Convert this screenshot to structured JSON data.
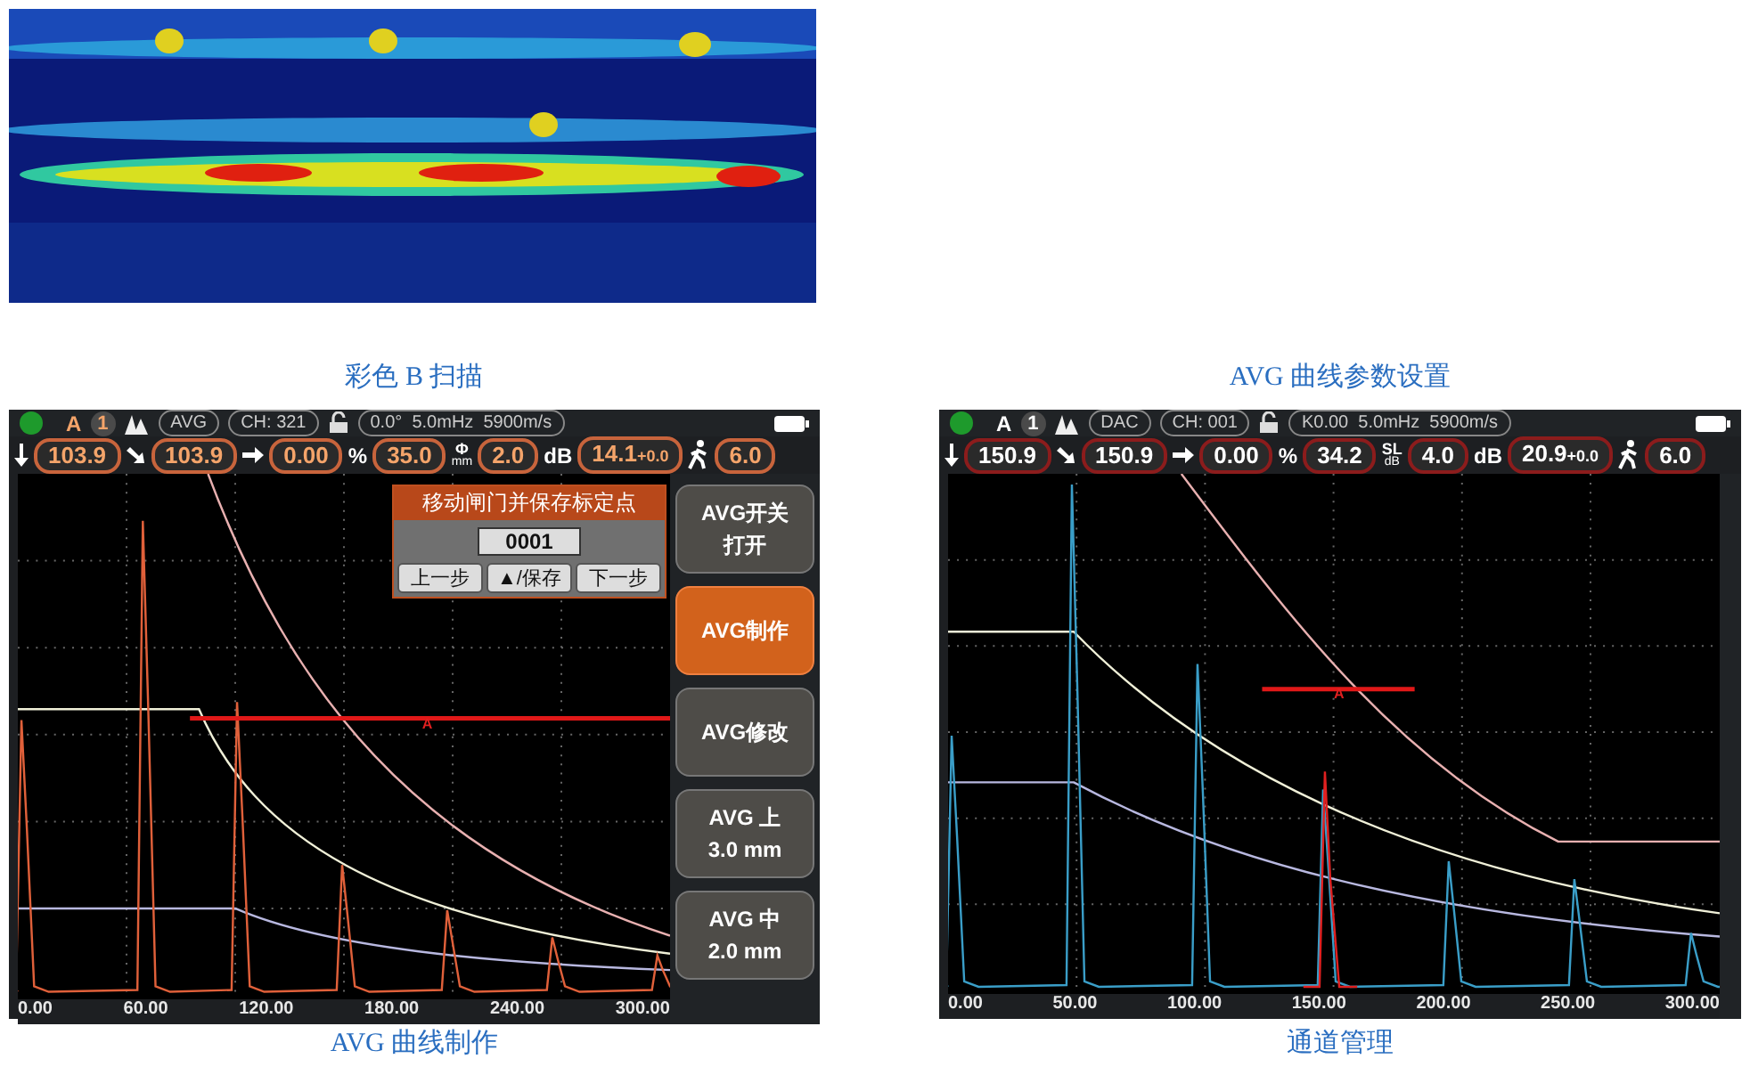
{
  "captions_top": [
    "彩色 B 扫描",
    "AVG 曲线参数设置"
  ],
  "screens": [
    {
      "kind": "orange",
      "mode": "A",
      "number": "1",
      "curve": "AVG",
      "channel": "CH: 321",
      "probe": "0.0°  5.0mHz  5900m/s",
      "readings": [
        {
          "kind": "down",
          "value": "103.9"
        },
        {
          "kind": "diag",
          "value": "103.9"
        },
        {
          "kind": "right",
          "value": "0.00"
        },
        {
          "kind": "label",
          "label": "%",
          "value": "35.0"
        },
        {
          "kind": "stack",
          "label": "Φ",
          "sub": "mm",
          "value": "2.0"
        },
        {
          "kind": "label",
          "label": "dB",
          "value": "14.1",
          "extra": "+0.0"
        },
        {
          "kind": "walker",
          "value": "6.0"
        }
      ],
      "gate_label": "A",
      "x_labels": [
        "0.00",
        "60.00",
        "120.00",
        "180.00",
        "240.00",
        "300.00"
      ],
      "dialog": {
        "title": "移动闸门并保存标定点",
        "value": "0001",
        "buttons": [
          "上一步",
          "▲/保存",
          "下一步"
        ]
      },
      "side_buttons": [
        {
          "lines": [
            "AVG开关",
            "打开"
          ],
          "selected": false
        },
        {
          "lines": [
            "AVG制作"
          ],
          "selected": true
        },
        {
          "lines": [
            "AVG修改"
          ],
          "selected": false
        },
        {
          "lines": [
            "AVG 上",
            "3.0 mm"
          ],
          "selected": false
        },
        {
          "lines": [
            "AVG 中",
            "2.0 mm"
          ],
          "selected": false
        }
      ],
      "caption": "AVG 曲线制作"
    },
    {
      "kind": "red",
      "mode": "A",
      "number": "1",
      "curve": "DAC",
      "channel": "CH: 001",
      "probe": "K0.00  5.0mHz  5900m/s",
      "readings": [
        {
          "kind": "down",
          "value": "150.9"
        },
        {
          "kind": "diag",
          "value": "150.9"
        },
        {
          "kind": "right",
          "value": "0.00"
        },
        {
          "kind": "label",
          "label": "%",
          "value": "34.2"
        },
        {
          "kind": "stack",
          "label": "SL",
          "sub": "dB",
          "value": "4.0"
        },
        {
          "kind": "label",
          "label": "dB",
          "value": "20.9",
          "extra": "+0.0"
        },
        {
          "kind": "walker",
          "value": "6.0"
        }
      ],
      "gate_label": "A",
      "x_labels": [
        "0.00",
        "50.00",
        "100.00",
        "150.00",
        "200.00",
        "250.00",
        "300.00"
      ],
      "caption": "通道管理"
    }
  ]
}
